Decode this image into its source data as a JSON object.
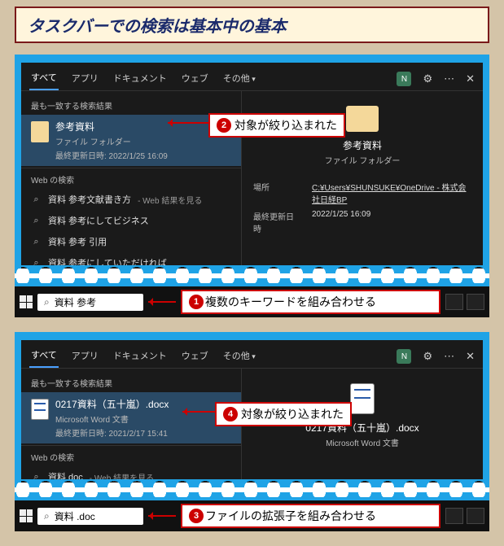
{
  "title": "タスクバーでの検索は基本中の基本",
  "tabs": {
    "all": "すべて",
    "apps": "アプリ",
    "docs": "ドキュメント",
    "web": "ウェブ",
    "more": "その他"
  },
  "win_badge": "N",
  "sections": {
    "best": "最も一致する検索結果",
    "web": "Web の検索"
  },
  "meta_labels": {
    "location": "場所",
    "updated": "最終更新日時"
  },
  "shot1": {
    "result": {
      "title": "参考資料",
      "sub": "ファイル フォルダー",
      "meta": "最終更新日時: 2022/1/25 16:09"
    },
    "web_rows": [
      {
        "q": "資料 参考文献書き方",
        "hint": " - Web 結果を見る"
      },
      {
        "q": "資料 参考にしてビジネス",
        "hint": ""
      },
      {
        "q": "資料 参考 引用",
        "hint": ""
      },
      {
        "q": "資料 参考にしていただければ",
        "hint": ""
      }
    ],
    "preview": {
      "title": "参考資料",
      "sub": "ファイル フォルダー",
      "location": "C:¥Users¥SHUNSUKE¥OneDrive - 株式会社日経BP",
      "updated": "2022/1/25 16:09"
    },
    "search_value": "資料 参考",
    "callout2": "対象が絞り込まれた",
    "callout1": "複数のキーワードを組み合わせる"
  },
  "shot2": {
    "result": {
      "title": "0217資料（五十嵐）.docx",
      "sub": "Microsoft Word 文書",
      "meta": "最終更新日時: 2021/2/17 15:41"
    },
    "web_rows": [
      {
        "q": "資料 doc",
        "hint": " - Web 結果を見る"
      }
    ],
    "preview": {
      "title": "0217資料（五十嵐）.docx",
      "sub": "Microsoft Word 文書"
    },
    "search_value": "資料 .doc",
    "callout4": "対象が絞り込まれた",
    "callout3": "ファイルの拡張子を組み合わせる"
  },
  "badges": {
    "n1": "1",
    "n2": "2",
    "n3": "3",
    "n4": "4"
  }
}
